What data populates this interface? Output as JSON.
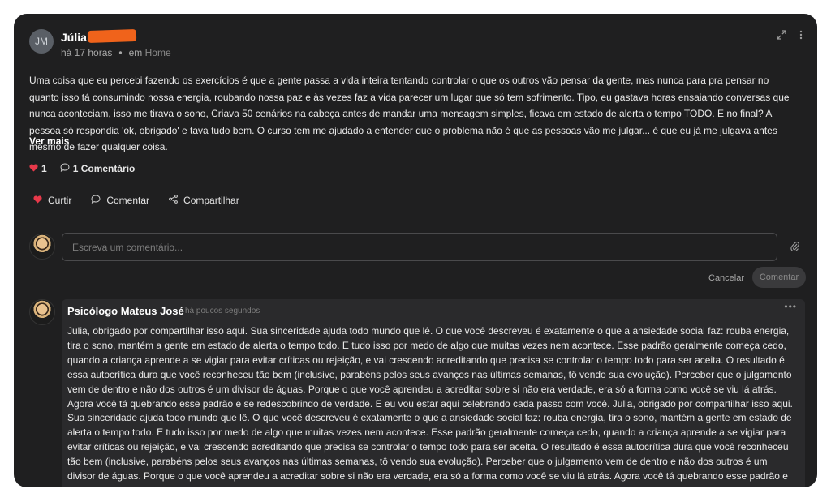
{
  "post": {
    "avatar_initials": "JM",
    "author": "Júlia",
    "time": "há 17 horas",
    "in_label": "em",
    "place": "Home",
    "body": "Uma coisa que eu percebi fazendo os exercícios é que a gente passa a vida inteira tentando controlar o que os outros vão pensar da gente, mas nunca para pra pensar no quanto isso tá consumindo nossa energia, roubando nossa paz e às vezes faz a vida parecer um lugar que só tem sofrimento. Tipo, eu gastava horas ensaiando conversas que nunca aconteciam, isso me tirava o sono, Criava 50 cenários na cabeça antes de mandar uma mensagem simples, ficava em estado de alerta o tempo TODO. E no final? A pessoa só respondia 'ok, obrigado' e tava tudo bem. O curso tem me ajudado a  entender que o problema não é que as pessoas vão me julgar... é que eu já me julgava antes mesmo de fazer qualquer coisa.",
    "see_more": "Ver mais",
    "likes": "1",
    "comments_count": "1 Comentário"
  },
  "actions": {
    "like": "Curtir",
    "comment": "Comentar",
    "share": "Compartilhar"
  },
  "composer": {
    "placeholder": "Escreva um comentário...",
    "cancel": "Cancelar",
    "submit": "Comentar"
  },
  "reply": {
    "author": "Psicólogo Mateus José",
    "time": "há poucos segundos",
    "text": "Julia, obrigado por compartilhar isso aqui. Sua sinceridade ajuda todo mundo que lê. O que você descreveu é exatamente o que a ansiedade social faz: rouba energia, tira o sono, mantém a gente em estado de alerta o tempo todo. E tudo isso por medo de algo que muitas vezes nem acontece. Esse padrão geralmente começa cedo, quando a criança aprende a se vigiar para evitar críticas ou rejeição, e vai crescendo acreditando que precisa se controlar o tempo todo para ser aceita. O resultado é essa autocrítica dura que você reconheceu tão bem (inclusive, parabéns pelos seus avanços nas últimas semanas, tô vendo sua evolução). Perceber que o julgamento vem de dentro e não dos outros é um divisor de águas. Porque o que você aprendeu a acreditar sobre si não era verdade, era só a forma como você se viu lá atrás. Agora você tá quebrando esse padrão e se redescobrindo de verdade. E eu vou estar aqui celebrando cada passo com você. Julia, obrigado por compartilhar isso aqui. Sua sinceridade ajuda todo mundo que lê. O que você descreveu é exatamente o que a ansiedade social faz: rouba energia, tira o sono, mantém a gente em estado de alerta o tempo todo. E tudo isso por medo de algo que muitas vezes nem acontece. Esse padrão geralmente começa cedo, quando a criança aprende a se vigiar para evitar críticas ou rejeição, e vai crescendo acreditando que precisa se controlar o tempo todo para ser aceita. O resultado é essa autocrítica dura que você reconheceu tão bem (inclusive, parabéns pelos seus avanços nas últimas semanas, tô vendo sua evolução). Perceber que o julgamento vem de dentro e não dos outros é um divisor de águas. Porque o que você aprendeu a acreditar sobre si não era verdade, era só a forma como você se viu lá atrás. Agora você tá quebrando esse padrão e se redescobrindo de verdade. E eu vou estar aqui celebrando cada passo com você."
  },
  "icons": {
    "expand": "expand-icon",
    "more": "more-vertical-icon",
    "heart": "heart-icon",
    "comment": "comment-bubble-icon",
    "share": "share-icon",
    "attach": "paperclip-icon"
  },
  "colors": {
    "background": "#1f1f20",
    "accent_heart": "#e8394a",
    "redaction": "#f0631b"
  }
}
